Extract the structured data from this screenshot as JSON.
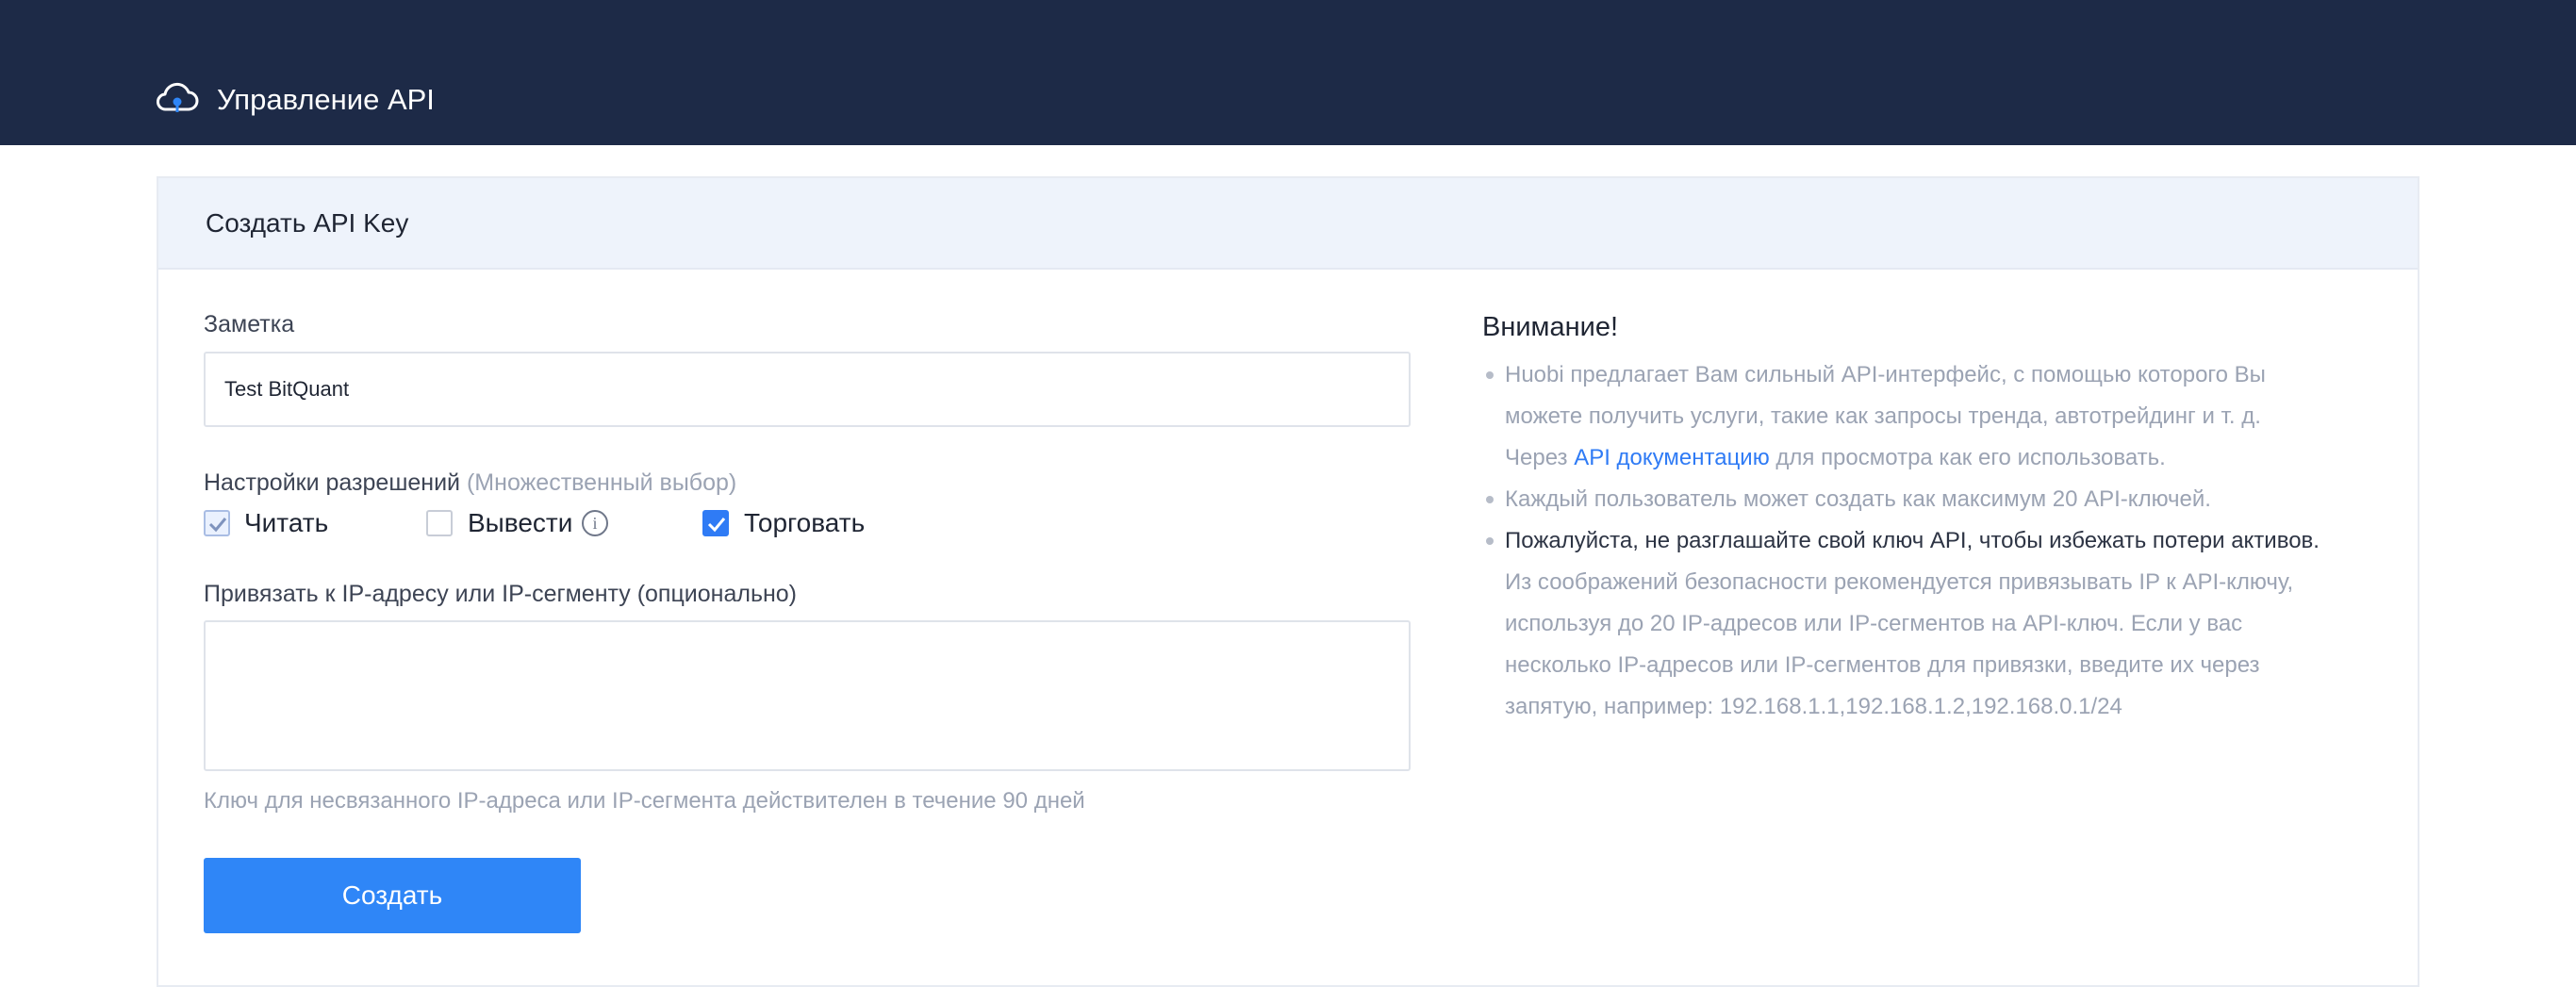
{
  "header": {
    "title": "Управление API",
    "icon": "cloud-key-icon"
  },
  "card": {
    "title": "Создать API Key",
    "note": {
      "label": "Заметка",
      "value": "Test BitQuant"
    },
    "permissions": {
      "label": "Настройки разрешений",
      "sub_label": "(Множественный выбор)",
      "options": [
        {
          "label": "Читать",
          "checked": true
        },
        {
          "label": "Вывести",
          "checked": false
        },
        {
          "label": "Торговать",
          "checked": true
        }
      ]
    },
    "ip": {
      "label": "Привязать к IP-адресу или IP-сегменту (опционально)",
      "value": "",
      "hint": "Ключ для несвязанного IP-адреса или IP-сегмента действителен в течение 90 дней"
    },
    "create_button": "Создать"
  },
  "notice": {
    "title": "Внимание!",
    "item1_line1": "Huobi предлагает Вам сильный API-интерфейс, с помощью которого Вы",
    "item1_line2": "можете получить услуги, такие как запросы тренда, автотрейдинг и т. д.",
    "item1_line3_prefix": "Через",
    "item1_link": "API документацию",
    "item1_line3_suffix": "для просмотра как его использовать.",
    "item2": "Каждый пользователь может создать как максимум 20 API-ключей.",
    "item3_line1": "Пожалуйста, не разглашайте свой ключ API, чтобы избежать потери активов.",
    "item3_line2": "Из соображений безопасности рекомендуется привязывать IP к API-ключу,",
    "item3_line3": "используя до 20 IP-адресов или IP-сегментов на API-ключ. Если у вас",
    "item3_line4": "несколько IP-адресов или IP-сегментов для привязки, введите их через",
    "item3_line5": "запятую, например: 192.168.1.1,192.168.1.2,192.168.0.1/24"
  },
  "colors": {
    "header_bg": "#1d2a47",
    "accent": "#2f86f7",
    "card_head_bg": "#eef3fb"
  }
}
